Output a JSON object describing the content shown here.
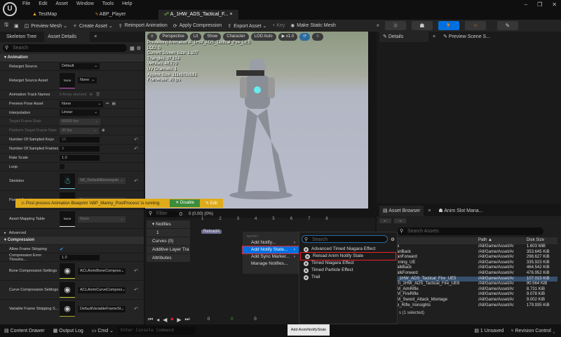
{
  "app": {
    "logo": "U",
    "menu": [
      "File",
      "Edit",
      "Asset",
      "Window",
      "Tools",
      "Help"
    ],
    "tabs": [
      {
        "label": "TestMap"
      },
      {
        "label": "ABP_Player"
      },
      {
        "label": "A_1HW_ADS_Tactical_F...",
        "close": "×"
      }
    ],
    "window_controls": [
      "–",
      "❐",
      "✕"
    ]
  },
  "toolbar": {
    "preview_mesh": "Preview Mesh ⌄",
    "create_asset": "Create Asset ⌄",
    "reimport": "Reimport Animation",
    "apply_compression": "Apply Compression",
    "export_asset": "Export Asset ⌄",
    "key": "+ Key",
    "make_static_mesh": "Make Static Mesh",
    "more": "»",
    "accent": "#0070e0"
  },
  "left_tabs": {
    "skeleton_tree": "Skeleton Tree",
    "asset_details": "Asset Details",
    "close": "×"
  },
  "details": {
    "search_placeholder": "Search",
    "animation_section": "Animation",
    "retarget_source": {
      "label": "Retarget Source",
      "value": "Default"
    },
    "retarget_source_asset": {
      "label": "Retarget Source Asset",
      "thumb": "None",
      "value": "None"
    },
    "track_names": {
      "label": "Animation Track Names",
      "value": "0 Array element"
    },
    "preview_pose": {
      "label": "Preview Pose Asset",
      "value": "None"
    },
    "interpolation": {
      "label": "Interpolation",
      "value": "Linear"
    },
    "target_frame_rate": {
      "label": "Target Frame Rate",
      "value": "60000 fps"
    },
    "platform_frame_rate": {
      "label": "Platform Target Frame Rate",
      "value": "30 fps"
    },
    "sampled_keys": {
      "label": "Number Of Sampled Keys",
      "value": "10"
    },
    "sampled_frames": {
      "label": "Number Of Sampled Frames",
      "value": "9"
    },
    "rate_scale": {
      "label": "Rate Scale",
      "value": "1.0"
    },
    "loop": {
      "label": "Loop"
    },
    "skeleton": {
      "label": "Skeleton",
      "value": "SK_DefaultMannequin"
    },
    "parent_asset": {
      "label": "Parent Asset",
      "thumb": "None",
      "value": "None"
    },
    "asset_mapping": {
      "label": "Asset Mapping Table",
      "thumb": "None",
      "value": "None"
    },
    "advanced": "Advanced",
    "compression_section": "Compression",
    "allow_stripping": {
      "label": "Allow Frame Stripping",
      "checked": true
    },
    "error_threshold": {
      "label": "Compression Error Thresho...",
      "value": "1.0"
    },
    "bone_compression": {
      "label": "Bone Compression Settings",
      "value": "ACLAnimBoneCompres"
    },
    "curve_compression": {
      "label": "Curve Compression Settings",
      "value": "ACLAnimCurveCompres"
    },
    "variable_stripping": {
      "label": "Variable Frame Stripping S...",
      "value": "DefaultVariableFrameSt"
    }
  },
  "viewport": {
    "buttons": [
      "Perspective",
      "Lit",
      "Show",
      "Character",
      "LOD Auto",
      "▶ x1.0"
    ],
    "stats": [
      "Previewing Animation A_1HW_ADS_Tactical_Fire_UE5",
      "LOD: 0",
      "Current Screen Size: 1.107",
      "Triangles: 97,174",
      "Vertices: 48,779",
      "UV Channels: 1",
      "Approx Size: 111x103x181",
      "Framerate: 30 fps"
    ],
    "warning": "⚠ Post process Animation Blueprint 'ABP_Manny_PostProcess' is running.",
    "disable": "✕ Disable",
    "edit": "✎ Edit"
  },
  "right_tabs": {
    "details": "Details",
    "close": "×",
    "preview_scene": "Preview Scene S..."
  },
  "timeline": {
    "filter_placeholder": "Filter",
    "count": "0",
    "time": "0 (0.00) (0%)",
    "ticks": [
      "1",
      "2",
      "3",
      "4",
      "5",
      "6",
      "7",
      "8"
    ],
    "tracks": [
      "Notifies",
      "1",
      "Curves (0)",
      "Additive Layer Tra",
      "Attributes"
    ],
    "notify": "ReloadA",
    "frames": [
      "0",
      "0",
      "0"
    ]
  },
  "context_menu": {
    "header": "NOTIFY",
    "items": [
      "Add Notify...",
      "Add Notify State...",
      "Add Sync Marker...",
      "Manage Notifies..."
    ]
  },
  "submenu": {
    "search_placeholder": "Search",
    "items": [
      "Advanced Timed Niagara Effect",
      "Reload Anim Notify State",
      "Timed Niagara Effect",
      "Timed Particle Effect",
      "Trail"
    ]
  },
  "tooltip": "Add AnimNotifyState",
  "asset_browser": {
    "tab": "Asset Browser",
    "close": "×",
    "tab2": "Anim Slot Mana...",
    "search_placeholder": "Search Assets",
    "columns": [
      "Name",
      "Path ▲",
      "Disk Size"
    ],
    "rows": [
      [
        "e",
        "/All/Game/Asset/Ar",
        "1.603 MiB"
      ],
      [
        "anBack",
        "/All/Game/Asset/Ar",
        "353.645 KiB"
      ],
      [
        "anForward",
        "/All/Game/Asset/Ar",
        "298.627 KiB"
      ],
      [
        "nning_UE",
        "/All/Game/Asset/Ar",
        "335.923 KiB"
      ],
      [
        "alkBack",
        "/All/Game/Asset/Ar",
        "464.542 KiB"
      ],
      [
        "alkForward",
        "/All/Game/Asset/Ar",
        "476.952 KiB"
      ],
      [
        "_1HW_ADS_Tactical_Fire_UE5",
        "/All/Game/Asset/Ar",
        "107.015 KiB"
      ],
      [
        "m_1HW_ADS_Tactical_Fire_UE6",
        "/All/Game/Asset/Ar",
        "90.564 KiB"
      ],
      [
        "M_AimRifle",
        "/All/Game/Asset/Ar",
        "8.731 KiB"
      ],
      [
        "M_FireRifle",
        "/All/Game/Asset/Ar",
        "9.078 KiB"
      ],
      [
        "M_Sword_Attack_Montage",
        "/All/Game/Asset/Ar",
        "9.002 KiB"
      ],
      [
        "e_Rifle_Ironsights",
        "/All/Game/Asset/Ar",
        "179.935 KiB"
      ]
    ],
    "selected_index": 6,
    "footer": "s (1 selected)"
  },
  "status": {
    "content_drawer": "Content Drawer",
    "output_log": "Output Log",
    "cmd": "Cmd ⌄",
    "console_placeholder": "Enter Console Command",
    "unsaved": "1 Unsaved",
    "revision_control": "Revision Control ⌄"
  }
}
